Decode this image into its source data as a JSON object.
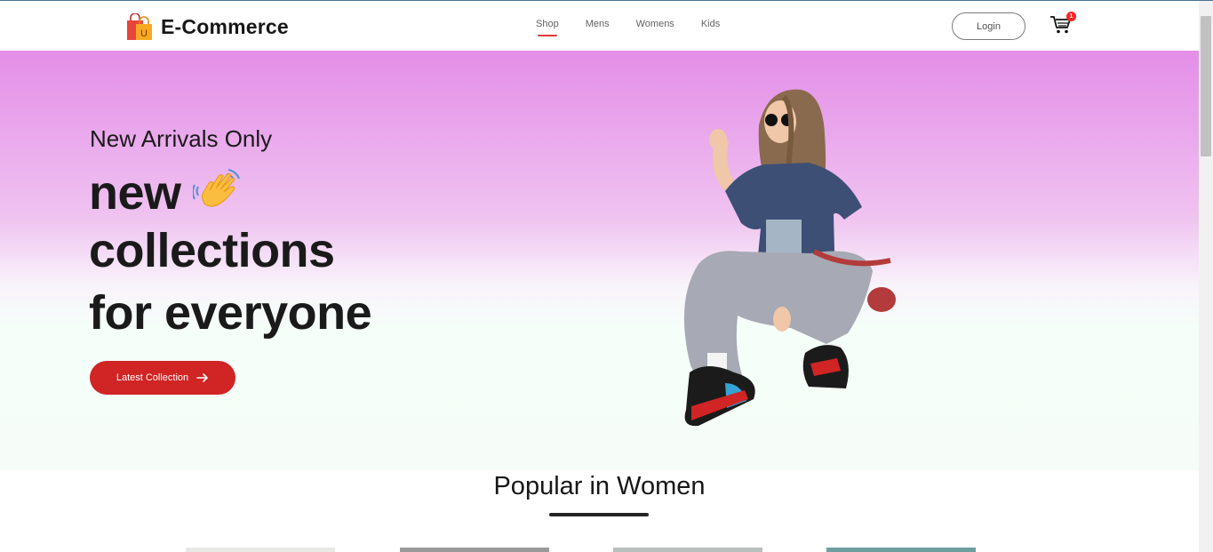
{
  "brand": {
    "name": "E-Commerce",
    "logo_icon": "shopping-bag-icon"
  },
  "nav": {
    "items": [
      {
        "label": "Shop",
        "active": true
      },
      {
        "label": "Mens",
        "active": false
      },
      {
        "label": "Womens",
        "active": false
      },
      {
        "label": "Kids",
        "active": false
      }
    ],
    "login_label": "Login",
    "cart_icon": "cart-icon",
    "cart_count": "1"
  },
  "hero": {
    "subtitle": "New Arrivals Only",
    "line1": "new",
    "line2": "collections",
    "line3": "for everyone",
    "wave_icon": "waving-hand-icon",
    "button_label": "Latest Collection",
    "button_icon": "arrow-right-icon"
  },
  "popular": {
    "title": "Popular in Women"
  },
  "colors": {
    "accent": "#d12424",
    "hero_top": "#e48ee8",
    "hero_bottom": "#f6fdf8",
    "badge": "#ff2222"
  }
}
